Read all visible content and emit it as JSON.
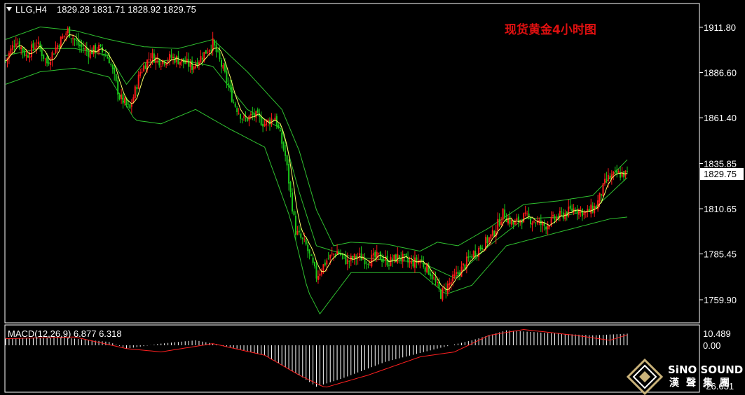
{
  "header": {
    "symbol_label": "LLG,H4",
    "ohlc": "1829.28 1831.71 1828.92 1829.75",
    "title_cn": "现货黄金4小时图"
  },
  "price_axis": {
    "ticks": [
      "1911.80",
      "1886.60",
      "1861.40",
      "1835.85",
      "1810.65",
      "1785.45",
      "1759.90"
    ],
    "current_price": "1829.75"
  },
  "macd": {
    "label": "MACD(12,26,9) 6.877 6.318",
    "ticks": [
      "10.489",
      "0.00",
      "-26.631"
    ]
  },
  "logo": {
    "name": "SINO SOUND",
    "name_display": "SiNO SOUND",
    "sub": "漢聲集團"
  },
  "colors": {
    "background": "#000000",
    "bull_candle": "#ff1a1a",
    "bear_candle": "#19c819",
    "bollinger": "#2fbf2f",
    "moving_average": "#ffff66",
    "macd_hist": "#ffffff",
    "macd_signal": "#ff2020",
    "title": "#e01010"
  },
  "chart_data": [
    {
      "type": "line",
      "name": "candlestick",
      "ylim": [
        1752,
        1920
      ],
      "axis_ticks": [
        1911.8,
        1886.6,
        1861.4,
        1835.85,
        1810.65,
        1785.45,
        1759.9
      ],
      "current": 1829.75,
      "price_path": [
        [
          0,
          1893
        ],
        [
          6,
          1905
        ],
        [
          12,
          1896
        ],
        [
          18,
          1903
        ],
        [
          24,
          1892
        ],
        [
          30,
          1902
        ],
        [
          36,
          1910
        ],
        [
          42,
          1902
        ],
        [
          48,
          1898
        ],
        [
          54,
          1900
        ],
        [
          60,
          1894
        ],
        [
          66,
          1873
        ],
        [
          72,
          1866
        ],
        [
          78,
          1887
        ],
        [
          84,
          1896
        ],
        [
          90,
          1893
        ],
        [
          96,
          1895
        ],
        [
          102,
          1893
        ],
        [
          108,
          1890
        ],
        [
          114,
          1896
        ],
        [
          120,
          1903
        ],
        [
          126,
          1888
        ],
        [
          132,
          1870
        ],
        [
          138,
          1860
        ],
        [
          144,
          1863
        ],
        [
          150,
          1858
        ],
        [
          156,
          1862
        ],
        [
          162,
          1840
        ],
        [
          168,
          1798
        ],
        [
          174,
          1790
        ],
        [
          180,
          1773
        ],
        [
          186,
          1782
        ],
        [
          192,
          1787
        ],
        [
          198,
          1781
        ],
        [
          204,
          1784
        ],
        [
          210,
          1782
        ],
        [
          216,
          1784
        ],
        [
          222,
          1781
        ],
        [
          228,
          1784
        ],
        [
          234,
          1780
        ],
        [
          240,
          1782
        ],
        [
          246,
          1775
        ],
        [
          252,
          1763
        ],
        [
          258,
          1770
        ],
        [
          264,
          1777
        ],
        [
          270,
          1785
        ],
        [
          276,
          1790
        ],
        [
          282,
          1796
        ],
        [
          288,
          1808
        ],
        [
          294,
          1802
        ],
        [
          300,
          1806
        ],
        [
          306,
          1804
        ],
        [
          312,
          1801
        ],
        [
          318,
          1805
        ],
        [
          324,
          1808
        ],
        [
          330,
          1811
        ],
        [
          336,
          1808
        ],
        [
          342,
          1812
        ],
        [
          348,
          1827
        ],
        [
          354,
          1830
        ],
        [
          360,
          1830
        ]
      ],
      "bollinger_upper": [
        [
          0,
          1905
        ],
        [
          20,
          1912
        ],
        [
          40,
          1910
        ],
        [
          60,
          1905
        ],
        [
          80,
          1901
        ],
        [
          100,
          1900
        ],
        [
          120,
          1905
        ],
        [
          140,
          1887
        ],
        [
          160,
          1866
        ],
        [
          170,
          1843
        ],
        [
          180,
          1810
        ],
        [
          190,
          1790
        ],
        [
          200,
          1792
        ],
        [
          220,
          1791
        ],
        [
          240,
          1787
        ],
        [
          250,
          1792
        ],
        [
          262,
          1790
        ],
        [
          280,
          1800
        ],
        [
          300,
          1813
        ],
        [
          320,
          1815
        ],
        [
          340,
          1818
        ],
        [
          360,
          1838
        ]
      ],
      "bollinger_middle": [
        [
          0,
          1896
        ],
        [
          20,
          1900
        ],
        [
          40,
          1900
        ],
        [
          60,
          1896
        ],
        [
          70,
          1880
        ],
        [
          80,
          1892
        ],
        [
          100,
          1894
        ],
        [
          120,
          1890
        ],
        [
          140,
          1866
        ],
        [
          160,
          1855
        ],
        [
          170,
          1820
        ],
        [
          180,
          1790
        ],
        [
          200,
          1784
        ],
        [
          220,
          1782
        ],
        [
          240,
          1781
        ],
        [
          260,
          1772
        ],
        [
          280,
          1790
        ],
        [
          300,
          1805
        ],
        [
          320,
          1806
        ],
        [
          340,
          1810
        ],
        [
          360,
          1828
        ]
      ],
      "bollinger_lower": [
        [
          0,
          1880
        ],
        [
          20,
          1887
        ],
        [
          40,
          1889
        ],
        [
          60,
          1884
        ],
        [
          75,
          1860
        ],
        [
          90,
          1858
        ],
        [
          110,
          1866
        ],
        [
          130,
          1855
        ],
        [
          150,
          1845
        ],
        [
          165,
          1805
        ],
        [
          175,
          1765
        ],
        [
          182,
          1752
        ],
        [
          200,
          1775
        ],
        [
          220,
          1775
        ],
        [
          240,
          1775
        ],
        [
          255,
          1763
        ],
        [
          270,
          1768
        ],
        [
          290,
          1790
        ],
        [
          310,
          1795
        ],
        [
          330,
          1800
        ],
        [
          350,
          1805
        ],
        [
          360,
          1806
        ]
      ]
    },
    {
      "type": "bar",
      "name": "MACD",
      "ylim": [
        -26.631,
        10.489
      ],
      "axis_ticks": [
        10.489,
        0.0,
        -26.631
      ],
      "macd_value": 6.877,
      "signal_value": 6.318,
      "histogram_profile": [
        [
          0,
          4
        ],
        [
          30,
          5
        ],
        [
          60,
          2
        ],
        [
          70,
          -2
        ],
        [
          90,
          1
        ],
        [
          110,
          3
        ],
        [
          130,
          -1
        ],
        [
          150,
          -6
        ],
        [
          170,
          -18
        ],
        [
          180,
          -25
        ],
        [
          195,
          -20
        ],
        [
          220,
          -10
        ],
        [
          250,
          -2
        ],
        [
          270,
          3
        ],
        [
          290,
          9
        ],
        [
          320,
          7
        ],
        [
          340,
          6
        ],
        [
          360,
          7
        ]
      ],
      "signal_profile": [
        [
          0,
          4
        ],
        [
          40,
          5
        ],
        [
          70,
          -2
        ],
        [
          90,
          -4
        ],
        [
          120,
          1
        ],
        [
          150,
          -6
        ],
        [
          170,
          -18
        ],
        [
          185,
          -25.5
        ],
        [
          210,
          -18
        ],
        [
          240,
          -7
        ],
        [
          260,
          -4
        ],
        [
          280,
          6
        ],
        [
          300,
          9.5
        ],
        [
          330,
          6
        ],
        [
          350,
          3
        ],
        [
          360,
          6.3
        ]
      ]
    }
  ]
}
